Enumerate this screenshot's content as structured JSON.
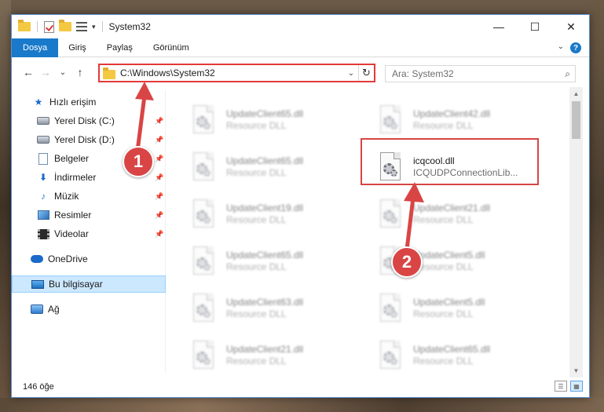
{
  "window": {
    "title": "System32",
    "minimize": "—",
    "maximize": "☐",
    "close": "✕"
  },
  "ribbon": {
    "tabs": [
      "Dosya",
      "Giriş",
      "Paylaş",
      "Görünüm"
    ],
    "expand_icon": "chevron-down-icon",
    "help_icon": "help-icon"
  },
  "nav": {
    "back": "←",
    "forward": "→",
    "recent": "⌄",
    "up": "↑",
    "address": "C:\\Windows\\System32",
    "search_placeholder": "Ara: System32"
  },
  "sidebar": {
    "items": [
      {
        "label": "Hızlı erişim",
        "icon": "star-icon",
        "pinned": false
      },
      {
        "label": "Yerel Disk (C:)",
        "icon": "disk-icon",
        "pinned": true
      },
      {
        "label": "Yerel Disk (D:)",
        "icon": "disk-icon",
        "pinned": true
      },
      {
        "label": "Belgeler",
        "icon": "documents-icon",
        "pinned": true
      },
      {
        "label": "İndirmeler",
        "icon": "download-icon",
        "pinned": true
      },
      {
        "label": "Müzik",
        "icon": "music-icon",
        "pinned": true
      },
      {
        "label": "Resimler",
        "icon": "pictures-icon",
        "pinned": true
      },
      {
        "label": "Videolar",
        "icon": "videos-icon",
        "pinned": true
      },
      {
        "label": "OneDrive",
        "icon": "onedrive-icon",
        "pinned": false
      },
      {
        "label": "Bu bilgisayar",
        "icon": "computer-icon",
        "pinned": false,
        "selected": true
      },
      {
        "label": "Ağ",
        "icon": "network-icon",
        "pinned": false
      }
    ]
  },
  "files": [
    {
      "name": "UpdateClient65.dll",
      "type": "Resource DLL"
    },
    {
      "name": "UpdateClient42.dll",
      "type": "Resource DLL"
    },
    {
      "name": "UpdateClient65.dll",
      "type": "Resource DLL"
    },
    {
      "name": "icqcool.dll",
      "type": "ICQUDPConnectionLib...",
      "highlighted": true
    },
    {
      "name": "UpdateClient19.dll",
      "type": "Resource DLL"
    },
    {
      "name": "UpdateClient21.dll",
      "type": "Resource DLL"
    },
    {
      "name": "UpdateClient65.dll",
      "type": "Resource DLL"
    },
    {
      "name": "UpdateClient5.dll",
      "type": "Resource DLL"
    },
    {
      "name": "UpdateClient63.dll",
      "type": "Resource DLL"
    },
    {
      "name": "UpdateClient5.dll",
      "type": "Resource DLL"
    },
    {
      "name": "UpdateClient21.dll",
      "type": "Resource DLL"
    },
    {
      "name": "UpdateClient65.dll",
      "type": "Resource DLL"
    }
  ],
  "status": {
    "count": "146 öğe"
  },
  "annotations": {
    "step1": "1",
    "step2": "2",
    "color": "#d94545"
  },
  "colors": {
    "accent": "#1979ca",
    "highlight": "#d64545",
    "selected_bg": "#cce8ff"
  }
}
